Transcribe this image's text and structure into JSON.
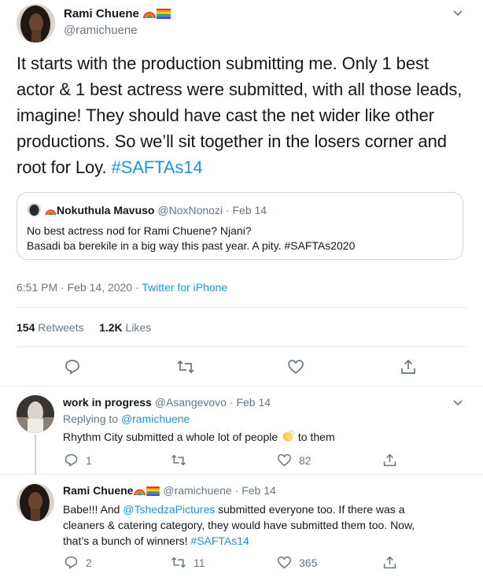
{
  "main_tweet": {
    "name": "Rami Chuene",
    "handle": "@ramichuene",
    "text": "It starts with the production submitting me. Only 1 best actor & 1 best actress were submitted, with all those leads, imagine! They should have cast the net wider like other productions. So we’ll sit together in the losers corner and root for Loy.",
    "hashtag": "#SAFTAs14",
    "quoted": {
      "name": "Nokuthula Mavuso",
      "handle": "@NoxNonozi",
      "date": "Feb 14",
      "line1": "No best actress nod for Rami Chuene? Njani?",
      "line2": "Basadi ba berekile in a big way this past year. A pity. #SAFTAs2020"
    },
    "timestamp": "6:51 PM · Feb 14, 2020",
    "separator": " · ",
    "source": "Twitter for iPhone",
    "retweets_count": "154",
    "retweets_label": "Retweets",
    "likes_count": "1.2K",
    "likes_label": "Likes"
  },
  "replies": [
    {
      "name": "work in progress",
      "handle": "@Asangevovo",
      "date": "Feb 14",
      "replying_prefix": "Replying to",
      "replying_to": "@ramichuene",
      "text_before": "Rhythm City submitted a whole lot of people",
      "text_after": "to them",
      "reply_count": "1",
      "retweet_count": "",
      "like_count": "82"
    },
    {
      "name": "Rami Chuene",
      "handle": "@ramichuene",
      "date": "Feb 14",
      "line1_before": "Babe!!! And",
      "line1_mention": "@TshedzaPictures",
      "line1_after": "submitted everyone too. If there was a",
      "line2": "cleaners & catering category, they would have submitted them too. Now,",
      "line3_text": "that’s a bunch of winners!",
      "line3_hashtag": "#SAFTAs14",
      "reply_count": "2",
      "retweet_count": "11",
      "like_count": "365"
    }
  ],
  "colors": {
    "link": "#1b95e0",
    "secondary_text": "#657786",
    "border": "#e6ecf0"
  }
}
